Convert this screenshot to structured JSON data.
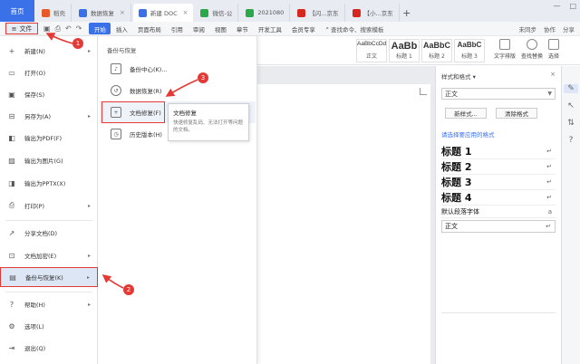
{
  "tabs": {
    "home": "首页",
    "items": [
      {
        "label": "稻壳",
        "icon_color": "#e8592a"
      },
      {
        "label": "数据恢复",
        "icon_color": "#3a70e8"
      },
      {
        "label": "新建 DOC",
        "icon_color": "#3a70e8"
      },
      {
        "label": "微信-公",
        "icon_color": "#2aa84a"
      },
      {
        "label": "2021080",
        "icon_color": "#2aa84a"
      },
      {
        "label": "【闪...京东",
        "icon_color": "#d7261d"
      },
      {
        "label": "【小...京东",
        "icon_color": "#d7261d"
      }
    ],
    "add": "+"
  },
  "ribbon": {
    "file_label": "文件",
    "menu_tabs": [
      "开始",
      "插入",
      "页面布局",
      "引用",
      "审阅",
      "视图",
      "章节",
      "开发工具",
      "会员专享"
    ],
    "search_label": "查找命令、搜索模板",
    "collab": [
      "未同步",
      "协作",
      "分享"
    ],
    "styles": [
      {
        "preview": "AaBbCcDd",
        "name": "正文"
      },
      {
        "preview": "AaBb",
        "name": "标题 1"
      },
      {
        "preview": "AaBbC",
        "name": "标题 2"
      },
      {
        "preview": "AaBbC",
        "name": "标题 3"
      }
    ],
    "right_buttons": [
      "文字排版",
      "查找替换",
      "选择"
    ]
  },
  "file_menu": {
    "items": [
      {
        "label": "新建(N)",
        "icon": "plus-icon",
        "has_arrow": true
      },
      {
        "label": "打开(O)",
        "icon": "folder-icon",
        "has_arrow": false
      },
      {
        "label": "保存(S)",
        "icon": "save-icon",
        "has_arrow": false
      },
      {
        "label": "另存为(A)",
        "icon": "save-as-icon",
        "has_arrow": true
      },
      {
        "label": "输出为PDF(F)",
        "icon": "pdf-icon",
        "has_arrow": false
      },
      {
        "label": "输出为图片(G)",
        "icon": "image-icon",
        "has_arrow": false
      },
      {
        "label": "输出为PPTX(X)",
        "icon": "pptx-icon",
        "has_arrow": false
      },
      {
        "label": "打印(P)",
        "icon": "print-icon",
        "has_arrow": true
      },
      {
        "label": "分享文档(D)",
        "icon": "share-icon",
        "has_arrow": false
      },
      {
        "label": "文档加密(E)",
        "icon": "lock-icon",
        "has_arrow": true
      },
      {
        "label": "备份与恢复(K)",
        "icon": "backup-icon",
        "has_arrow": true
      },
      {
        "label": "帮助(H)",
        "icon": "help-icon",
        "has_arrow": true
      },
      {
        "label": "选项(L)",
        "icon": "gear-icon",
        "has_arrow": false
      },
      {
        "label": "退出(Q)",
        "icon": "exit-icon",
        "has_arrow": false
      }
    ]
  },
  "submenu": {
    "title": "备份与恢复",
    "items": [
      "备份中心(K)...",
      "数据恢复(R)",
      "文档修复(F)",
      "历史版本(H)"
    ]
  },
  "tooltip": {
    "title": "文档修复",
    "desc": "快速修复乱码、无法打开等问题的文档。"
  },
  "pane": {
    "title": "样式和格式 ▾",
    "current_style": "正文",
    "new_style": "新样式...",
    "clear_format": "清除格式",
    "apply_label": "请选择要应用的格式",
    "styles": [
      {
        "label": "标题 1",
        "kind": "heading"
      },
      {
        "label": "标题 2",
        "kind": "heading"
      },
      {
        "label": "标题 3",
        "kind": "heading"
      },
      {
        "label": "标题 4",
        "kind": "heading"
      },
      {
        "label": "默认段落字体",
        "kind": "small"
      },
      {
        "label": "正文",
        "kind": "boxed"
      }
    ],
    "para_mark": "↵",
    "char_mark": "a"
  },
  "markers": [
    "1",
    "2",
    "3"
  ],
  "colors": {
    "accent": "#3a70e8",
    "highlight_red": "#e53935"
  }
}
